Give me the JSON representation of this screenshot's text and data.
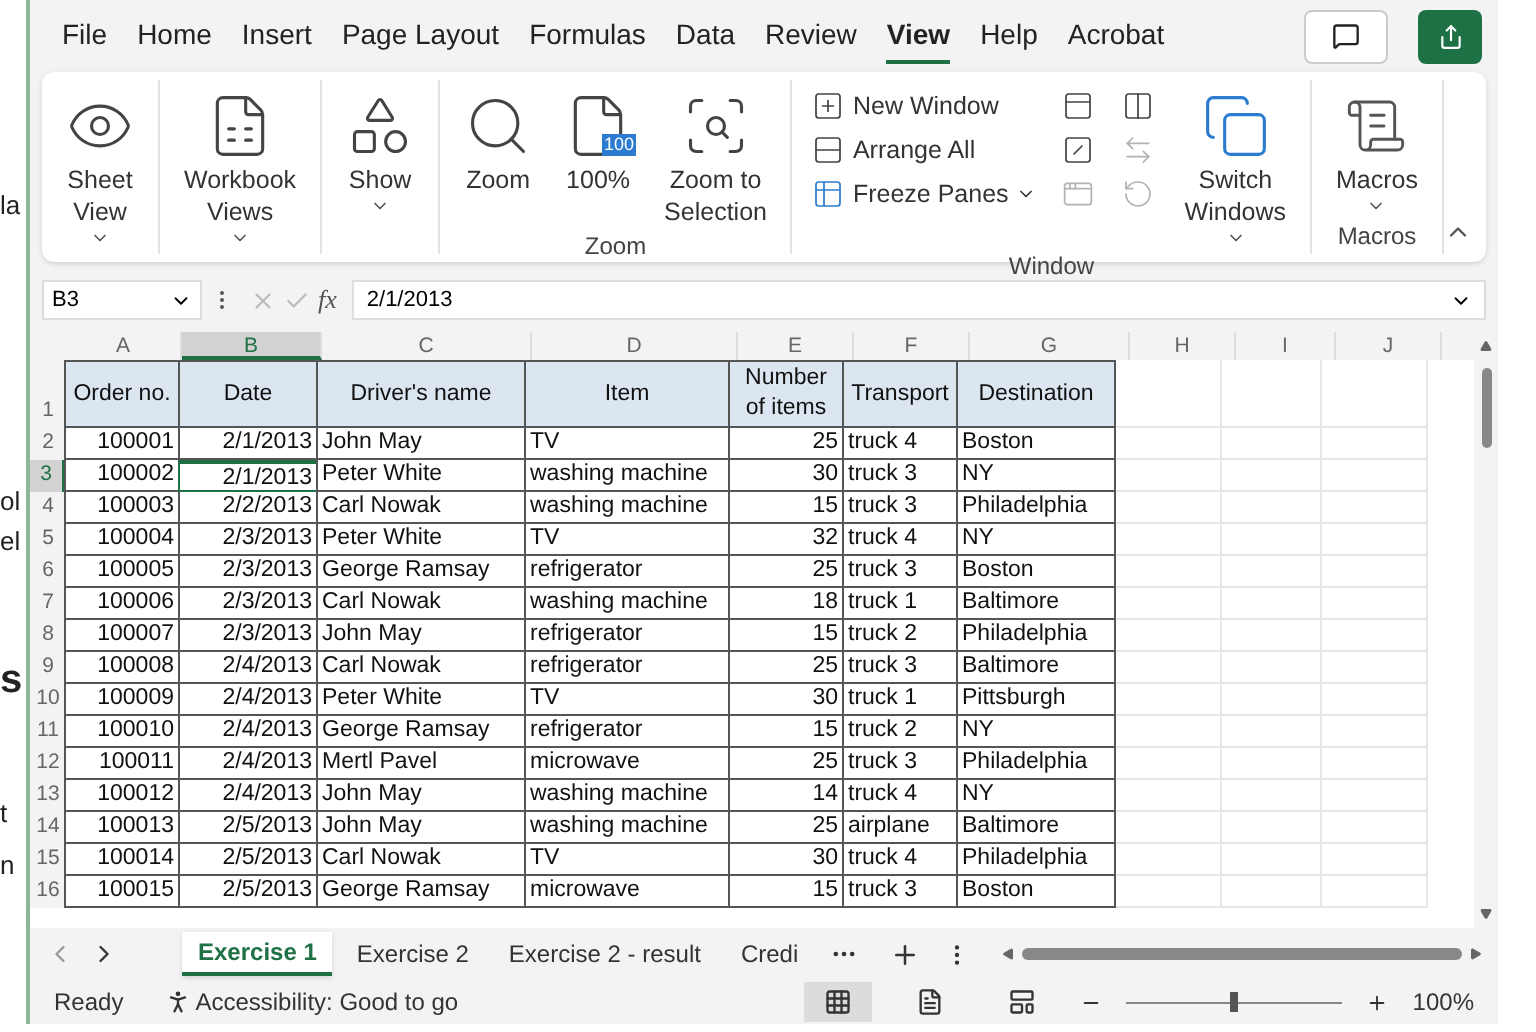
{
  "background_fragments": [
    {
      "text": "la",
      "kind": "plain"
    },
    {
      "text": "ol",
      "kind": "plain"
    },
    {
      "text": "el",
      "kind": "plain"
    },
    {
      "text": "s",
      "kind": "heading"
    },
    {
      "text": "t",
      "kind": "plain"
    },
    {
      "text": "n",
      "kind": "plain"
    }
  ],
  "menu": [
    {
      "label": "File",
      "selected": false
    },
    {
      "label": "Home",
      "selected": false
    },
    {
      "label": "Insert",
      "selected": false
    },
    {
      "label": "Page Layout",
      "selected": false
    },
    {
      "label": "Formulas",
      "selected": false
    },
    {
      "label": "Data",
      "selected": false
    },
    {
      "label": "Review",
      "selected": false
    },
    {
      "label": "View",
      "selected": true
    },
    {
      "label": "Help",
      "selected": false
    },
    {
      "label": "Acrobat",
      "selected": false
    }
  ],
  "ribbon": {
    "groups": [
      {
        "buttons": [
          {
            "kind": "large",
            "label": "Sheet View",
            "dropdown": true
          }
        ]
      },
      {
        "buttons": [
          {
            "kind": "large",
            "label": "Workbook Views",
            "dropdown": true
          }
        ]
      },
      {
        "buttons": [
          {
            "kind": "large",
            "label": "Show",
            "dropdown": true
          }
        ]
      },
      {
        "label": "Zoom",
        "buttons": [
          {
            "kind": "large",
            "label": "Zoom",
            "dropdown": false
          },
          {
            "kind": "large",
            "badge": "100",
            "label": "100%",
            "dropdown": false
          },
          {
            "kind": "large",
            "label": "Zoom to Selection",
            "dropdown": false
          }
        ]
      },
      {
        "label": "Window",
        "buttons": [
          {
            "kind": "small",
            "label": "New Window",
            "dropdown": false
          },
          {
            "kind": "small",
            "label": "Arrange All",
            "dropdown": false
          },
          {
            "kind": "small",
            "label": "Freeze Panes",
            "dropdown": true
          },
          {
            "kind": "tiny",
            "disabled": false
          },
          {
            "kind": "tiny",
            "disabled": false
          },
          {
            "kind": "tiny",
            "disabled": true
          },
          {
            "kind": "tiny",
            "disabled": false
          },
          {
            "kind": "tiny",
            "disabled": true
          },
          {
            "kind": "tiny",
            "disabled": true
          },
          {
            "kind": "large",
            "label": "Switch Windows",
            "dropdown": true
          }
        ]
      },
      {
        "label": "Macros",
        "buttons": [
          {
            "kind": "large",
            "label": "Macros",
            "dropdown": true
          }
        ]
      }
    ]
  },
  "formula_bar": {
    "name_box": "B3",
    "function_label": "fx",
    "formula": "2/1/2013"
  },
  "columns": [
    {
      "label": "A",
      "selected": false
    },
    {
      "label": "B",
      "selected": true
    },
    {
      "label": "C",
      "selected": false
    },
    {
      "label": "D",
      "selected": false
    },
    {
      "label": "E",
      "selected": false
    },
    {
      "label": "F",
      "selected": false
    },
    {
      "label": "G",
      "selected": false
    },
    {
      "label": "H",
      "selected": false
    },
    {
      "label": "I",
      "selected": false
    },
    {
      "label": "J",
      "selected": false
    }
  ],
  "header_row": {
    "number": "1",
    "cells": [
      "Order no.",
      "Date",
      "Driver's name",
      "Item",
      "Number of items",
      "Transport",
      "Destination"
    ]
  },
  "rows": [
    {
      "number": "2",
      "selected": false,
      "cells": [
        "100001",
        "2/1/2013",
        "John May",
        "TV",
        "25",
        "truck 4",
        "Boston"
      ]
    },
    {
      "number": "3",
      "selected": true,
      "cells": [
        "100002",
        "2/1/2013",
        "Peter White",
        "washing machine",
        "30",
        "truck 3",
        "NY"
      ]
    },
    {
      "number": "4",
      "selected": false,
      "cells": [
        "100003",
        "2/2/2013",
        "Carl Nowak",
        "washing machine",
        "15",
        "truck 3",
        "Philadelphia"
      ]
    },
    {
      "number": "5",
      "selected": false,
      "cells": [
        "100004",
        "2/3/2013",
        "Peter White",
        "TV",
        "32",
        "truck 4",
        "NY"
      ]
    },
    {
      "number": "6",
      "selected": false,
      "cells": [
        "100005",
        "2/3/2013",
        "George Ramsay",
        "refrigerator",
        "25",
        "truck 3",
        "Boston"
      ]
    },
    {
      "number": "7",
      "selected": false,
      "cells": [
        "100006",
        "2/3/2013",
        "Carl Nowak",
        "washing machine",
        "18",
        "truck 1",
        "Baltimore"
      ]
    },
    {
      "number": "8",
      "selected": false,
      "cells": [
        "100007",
        "2/3/2013",
        "John May",
        "refrigerator",
        "15",
        "truck 2",
        "Philadelphia"
      ]
    },
    {
      "number": "9",
      "selected": false,
      "cells": [
        "100008",
        "2/4/2013",
        "Carl Nowak",
        "refrigerator",
        "25",
        "truck 3",
        "Baltimore"
      ]
    },
    {
      "number": "10",
      "selected": false,
      "cells": [
        "100009",
        "2/4/2013",
        "Peter White",
        "TV",
        "30",
        "truck 1",
        "Pittsburgh"
      ]
    },
    {
      "number": "11",
      "selected": false,
      "cells": [
        "100010",
        "2/4/2013",
        "George Ramsay",
        "refrigerator",
        "15",
        "truck 2",
        "NY"
      ]
    },
    {
      "number": "12",
      "selected": false,
      "cells": [
        "100011",
        "2/4/2013",
        "Mertl Pavel",
        "microwave",
        "25",
        "truck 3",
        "Philadelphia"
      ]
    },
    {
      "number": "13",
      "selected": false,
      "cells": [
        "100012",
        "2/4/2013",
        "John May",
        "washing machine",
        "14",
        "truck 4",
        "NY"
      ]
    },
    {
      "number": "14",
      "selected": false,
      "cells": [
        "100013",
        "2/5/2013",
        "John May",
        "washing machine",
        "25",
        "airplane",
        "Baltimore"
      ]
    },
    {
      "number": "15",
      "selected": false,
      "cells": [
        "100014",
        "2/5/2013",
        "Carl Nowak",
        "TV",
        "30",
        "truck 4",
        "Philadelphia"
      ]
    },
    {
      "number": "16",
      "selected": false,
      "cells": [
        "100015",
        "2/5/2013",
        "George Ramsay",
        "microwave",
        "15",
        "truck 3",
        "Boston"
      ]
    }
  ],
  "sheet_tabs": [
    {
      "label": "Exercise 1",
      "selected": true
    },
    {
      "label": "Exercise 2",
      "selected": false
    },
    {
      "label": "Exercise 2 - result",
      "selected": false
    },
    {
      "label": "Credi",
      "selected": false
    }
  ],
  "status_bar": {
    "mode": "Ready",
    "accessibility": "Accessibility: Good to go",
    "views": [
      {
        "kind": "normal",
        "selected": true
      },
      {
        "kind": "page_layout",
        "selected": false
      },
      {
        "kind": "page_break",
        "selected": false
      }
    ],
    "zoom": {
      "level": 0.5,
      "reading": "100%"
    }
  }
}
